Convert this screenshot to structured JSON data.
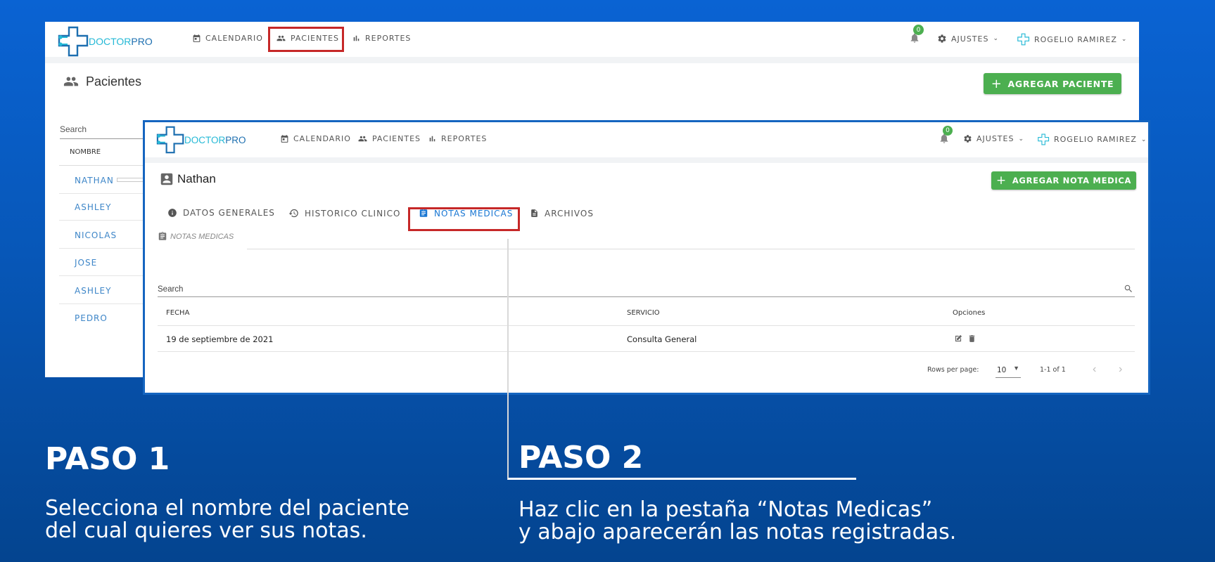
{
  "app": {
    "logo_doc": "DOCTOR",
    "logo_pro": "PRO"
  },
  "nav": {
    "calendario": "CALENDARIO",
    "pacientes": "PACIENTES",
    "reportes": "REPORTES",
    "notification_count": "0",
    "ajustes": "AJUSTES",
    "user": "ROGELIO RAMIREZ"
  },
  "patients_page": {
    "title": "Pacientes",
    "add_button": "AGREGAR PACIENTE",
    "search_label": "Search",
    "column_nombre": "NOMBRE",
    "patients": [
      "NATHAN",
      "ASHLEY",
      "NICOLAS",
      "JOSE",
      "ASHLEY",
      "PEDRO"
    ]
  },
  "patient_detail": {
    "name": "Nathan",
    "add_button": "AGREGAR NOTA MEDICA",
    "tabs": [
      "DATOS GENERALES",
      "HISTORICO CLINICO",
      "NOTAS MEDICAS",
      "ARCHIVOS"
    ],
    "section_title": "NOTAS MEDICAS",
    "search_label": "Search",
    "table": {
      "headers": [
        "FECHA",
        "SERVICIO",
        "Opciones"
      ],
      "rows": [
        {
          "fecha": "19 de septiembre de 2021",
          "servicio": "Consulta General"
        }
      ]
    },
    "pagination": {
      "rows_per_page_label": "Rows per page:",
      "rows_per_page": "10",
      "range": "1-1 of 1"
    }
  },
  "steps": {
    "step1_title": "PASO 1",
    "step1_line1": "Selecciona el nombre del paciente",
    "step1_line2": "del cual quieres ver sus notas.",
    "step2_title": "PASO 2",
    "step2_line1": "Haz clic en la pestaña “Notas Medicas”",
    "step2_line2": "y abajo aparecerán las notas registradas."
  },
  "colors": {
    "accent_green": "#4caf50",
    "highlight_red": "#c62828",
    "link_blue": "#1976d2",
    "background_blue": "#0757b8"
  }
}
